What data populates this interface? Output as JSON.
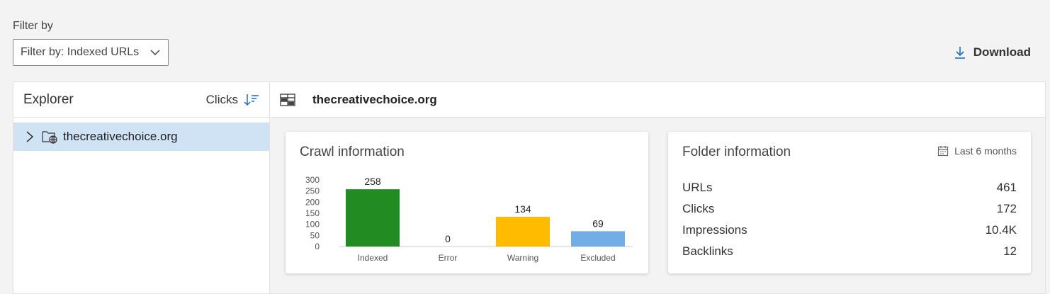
{
  "filter": {
    "label": "Filter by",
    "selected": "Filter by: Indexed URLs",
    "chevron_icon": "chevron-down-icon"
  },
  "download": {
    "label": "Download",
    "icon": "download-icon"
  },
  "explorer": {
    "title": "Explorer",
    "sort_label": "Clicks",
    "sort_icon": "sort-descending-icon",
    "tree": [
      {
        "label": "thecreativechoice.org",
        "icon": "web-folder-icon",
        "expanded": false,
        "selected": true
      }
    ]
  },
  "main": {
    "site_title": "thecreativechoice.org",
    "site_icon": "site-explorer-icon"
  },
  "crawl": {
    "title": "Crawl information"
  },
  "folder": {
    "title": "Folder information",
    "range_label": "Last 6 months",
    "range_icon": "calendar-icon",
    "stats": [
      {
        "label": "URLs",
        "value": "461"
      },
      {
        "label": "Clicks",
        "value": "172"
      },
      {
        "label": "Impressions",
        "value": "10.4K"
      },
      {
        "label": "Backlinks",
        "value": "12"
      }
    ]
  },
  "chart_data": {
    "type": "bar",
    "categories": [
      "Indexed",
      "Error",
      "Warning",
      "Excluded"
    ],
    "values": [
      258,
      0,
      134,
      69
    ],
    "value_labels": [
      "258",
      "0",
      "134",
      "69"
    ],
    "colors": [
      "#228b22",
      "#888888",
      "#ffbb00",
      "#72ade6"
    ],
    "yticks": [
      "0",
      "50",
      "100",
      "150",
      "200",
      "250",
      "300"
    ],
    "ylim": [
      0,
      300
    ],
    "grid": false
  }
}
